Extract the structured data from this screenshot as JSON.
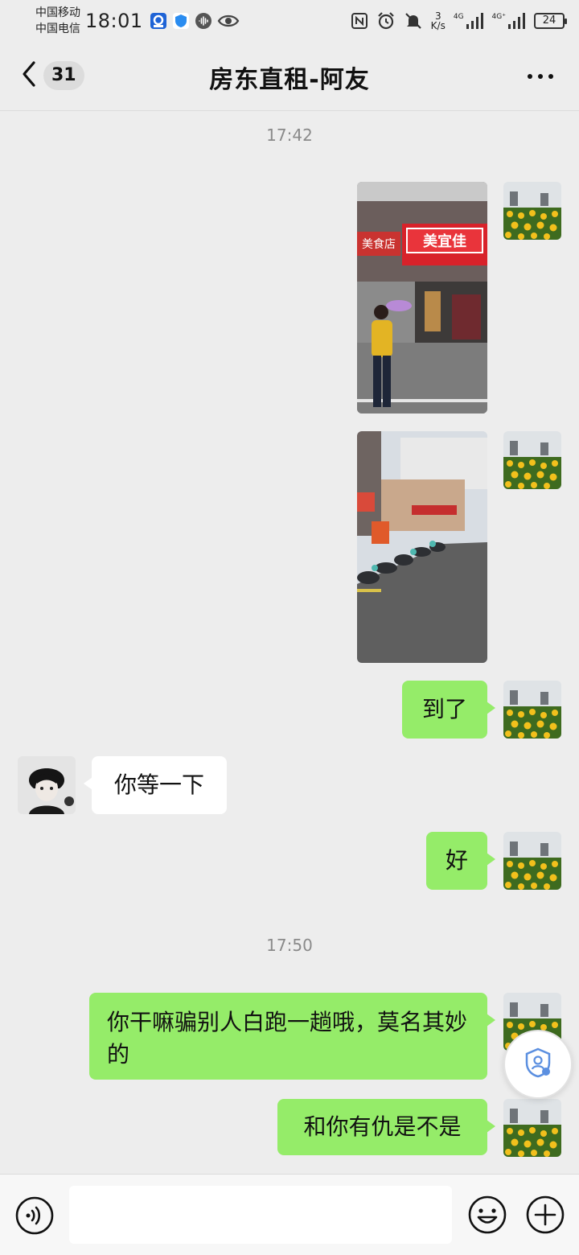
{
  "status_bar": {
    "carrier_1": "中国移动",
    "carrier_2": "中国电信",
    "time": "18:01",
    "net_speed_value": "3",
    "net_speed_unit": "K/s",
    "signal_1_label": "4G",
    "signal_2_label": "4G⁺",
    "battery": "24"
  },
  "header": {
    "unread_count": "31",
    "title": "房东直租-阿友"
  },
  "chat": {
    "time_1": "17:42",
    "msg_arrived": "到了",
    "msg_wait": "你等一下",
    "msg_ok": "好",
    "time_2": "17:50",
    "msg_complaint": "你干嘛骗别人白跑一趟哦，莫名其妙的",
    "msg_grudge": "和你有仇是不是",
    "photo_1_sign": "美宜佳",
    "photo_1_sign_left": "美食店"
  },
  "colors": {
    "my_bubble": "#95ec69",
    "their_bubble": "#ffffff",
    "background": "#ededed"
  },
  "icons": {
    "back": "chevron-left-icon",
    "more": "more-dots-icon",
    "voice": "voice-icon",
    "emoji": "emoji-icon",
    "plus": "plus-circle-icon",
    "float": "shield-user-icon"
  }
}
